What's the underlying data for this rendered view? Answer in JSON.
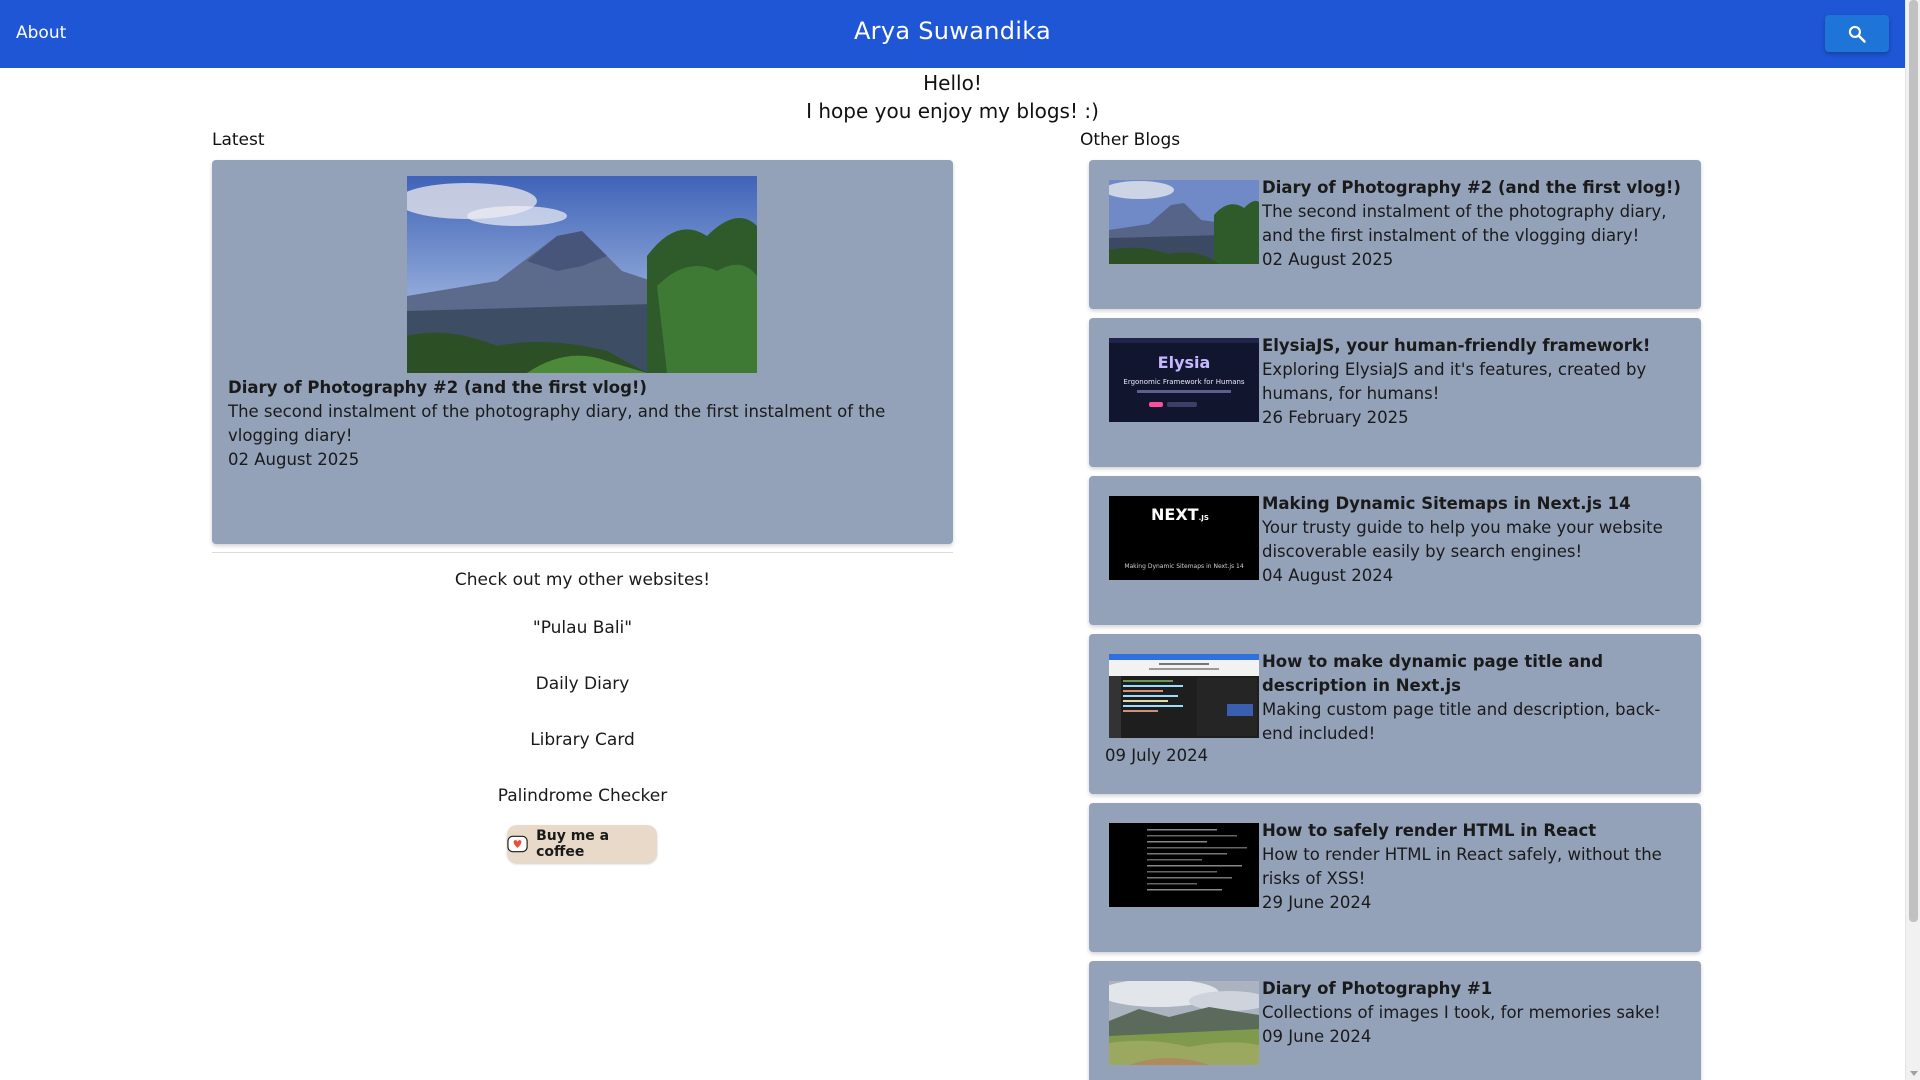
{
  "header": {
    "about_label": "About",
    "site_title": "Arya Suwandika",
    "search_icon": "search-icon"
  },
  "intro": {
    "line1": "Hello!",
    "line2": "I hope you enjoy my blogs! :)"
  },
  "latest": {
    "section_label": "Latest",
    "title": "Diary of Photography #2 (and the first vlog!)",
    "description": "The second instalment of the photography diary, and the first instalment of the vlogging diary!",
    "date": "02 August 2025"
  },
  "other_websites": {
    "title": "Check out my other websites!",
    "links": [
      "\"Pulau Bali\"",
      "Daily Diary",
      "Library Card",
      "Palindrome Checker"
    ],
    "coffee_label": "Buy me a coffee"
  },
  "other_blogs": {
    "section_label": "Other Blogs",
    "items": [
      {
        "title": "Diary of Photography #2 (and the first vlog!)",
        "description": "The second instalment of the photography diary, and the first instalment of the vlogging diary!",
        "date": "02 August 2025"
      },
      {
        "title": "ElysiaJS, your human-friendly framework!",
        "description": "Exploring ElysiaJS and it's features, created by humans, for humans!",
        "date": "26 February 2025"
      },
      {
        "title": "Making Dynamic Sitemaps in Next.js 14",
        "description": "Your trusty guide to help you make your website discoverable easily by search engines!",
        "date": "04 August 2024"
      },
      {
        "title": "How to make dynamic page title and description in Next.js",
        "description": "Making custom page title and description, back-end included!",
        "date": "09 July 2024"
      },
      {
        "title": "How to safely render HTML in React",
        "description": "How to render HTML in React safely, without the risks of XSS!",
        "date": "29 June 2024"
      },
      {
        "title": "Diary of Photography #1",
        "description": "Collections of images I took, for memories sake!",
        "date": "09 June 2024"
      }
    ],
    "thumb_text": {
      "elysia_logo": "Elysia",
      "elysia_tagline": "Ergonomic Framework for Humans",
      "next_logo": "NEXT",
      "next_logo_suffix": ".JS",
      "next_caption": "Making Dynamic Sitemaps in Next.js 14"
    }
  }
}
